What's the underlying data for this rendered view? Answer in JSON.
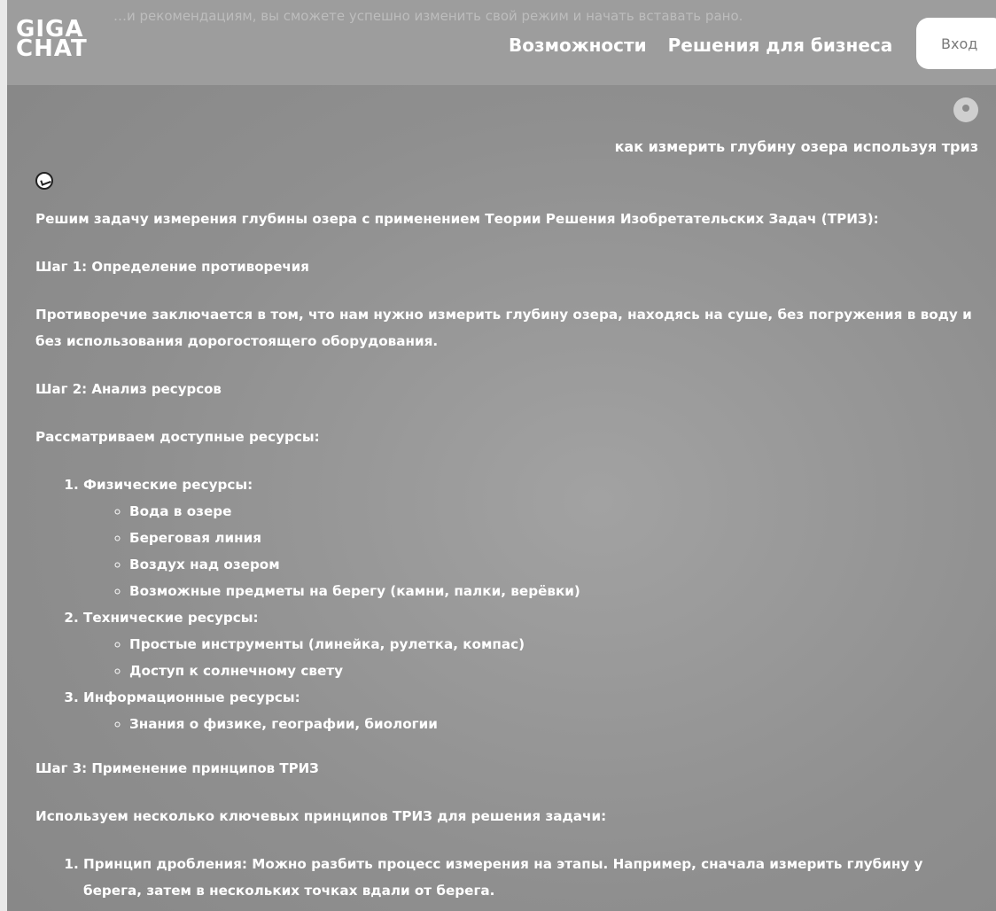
{
  "header": {
    "ghost_text": "…и рекомендациям, вы сможете успешно изменить свой режим и начать вставать рано.",
    "logo_line1": "GIGA",
    "logo_line2": "CHAT",
    "nav": [
      "Возможности",
      "Решения для бизнеса"
    ],
    "login_label": "Вход"
  },
  "chat": {
    "user_message": "как измерить глубину озера используя триз",
    "answer": {
      "intro": "Решим задачу измерения глубины озера с применением Теории Решения Изобретательских Задач (ТРИЗ):",
      "step1_title": "Шаг 1: Определение противоречия",
      "step1_text": "Противоречие заключается в том, что нам нужно измерить глубину озера, находясь на суше, без погружения в воду и без использования дорогостоящего оборудования.",
      "step2_title": "Шаг 2: Анализ ресурсов",
      "step2_intro": "Рассматриваем доступные ресурсы:",
      "resources": [
        {
          "title": "Физические ресурсы:",
          "items": [
            "Вода в озере",
            "Береговая линия",
            "Воздух над озером",
            "Возможные предметы на берегу (камни, палки, верёвки)"
          ]
        },
        {
          "title": "Технические ресурсы:",
          "items": [
            "Простые инструменты (линейка, рулетка, компас)",
            "Доступ к солнечному свету"
          ]
        },
        {
          "title": "Информационные ресурсы:",
          "items": [
            "Знания о физике, географии, биологии"
          ]
        }
      ],
      "step3_title": "Шаг 3: Применение принципов ТРИЗ",
      "step3_intro": "Используем несколько ключевых принципов ТРИЗ для решения задачи:",
      "principles": [
        {
          "title": "Принцип дробления:",
          "text": "Можно разбить процесс измерения на этапы. Например, сначала измерить глубину у берега, затем в нескольких точках вдали от берега."
        }
      ]
    }
  }
}
